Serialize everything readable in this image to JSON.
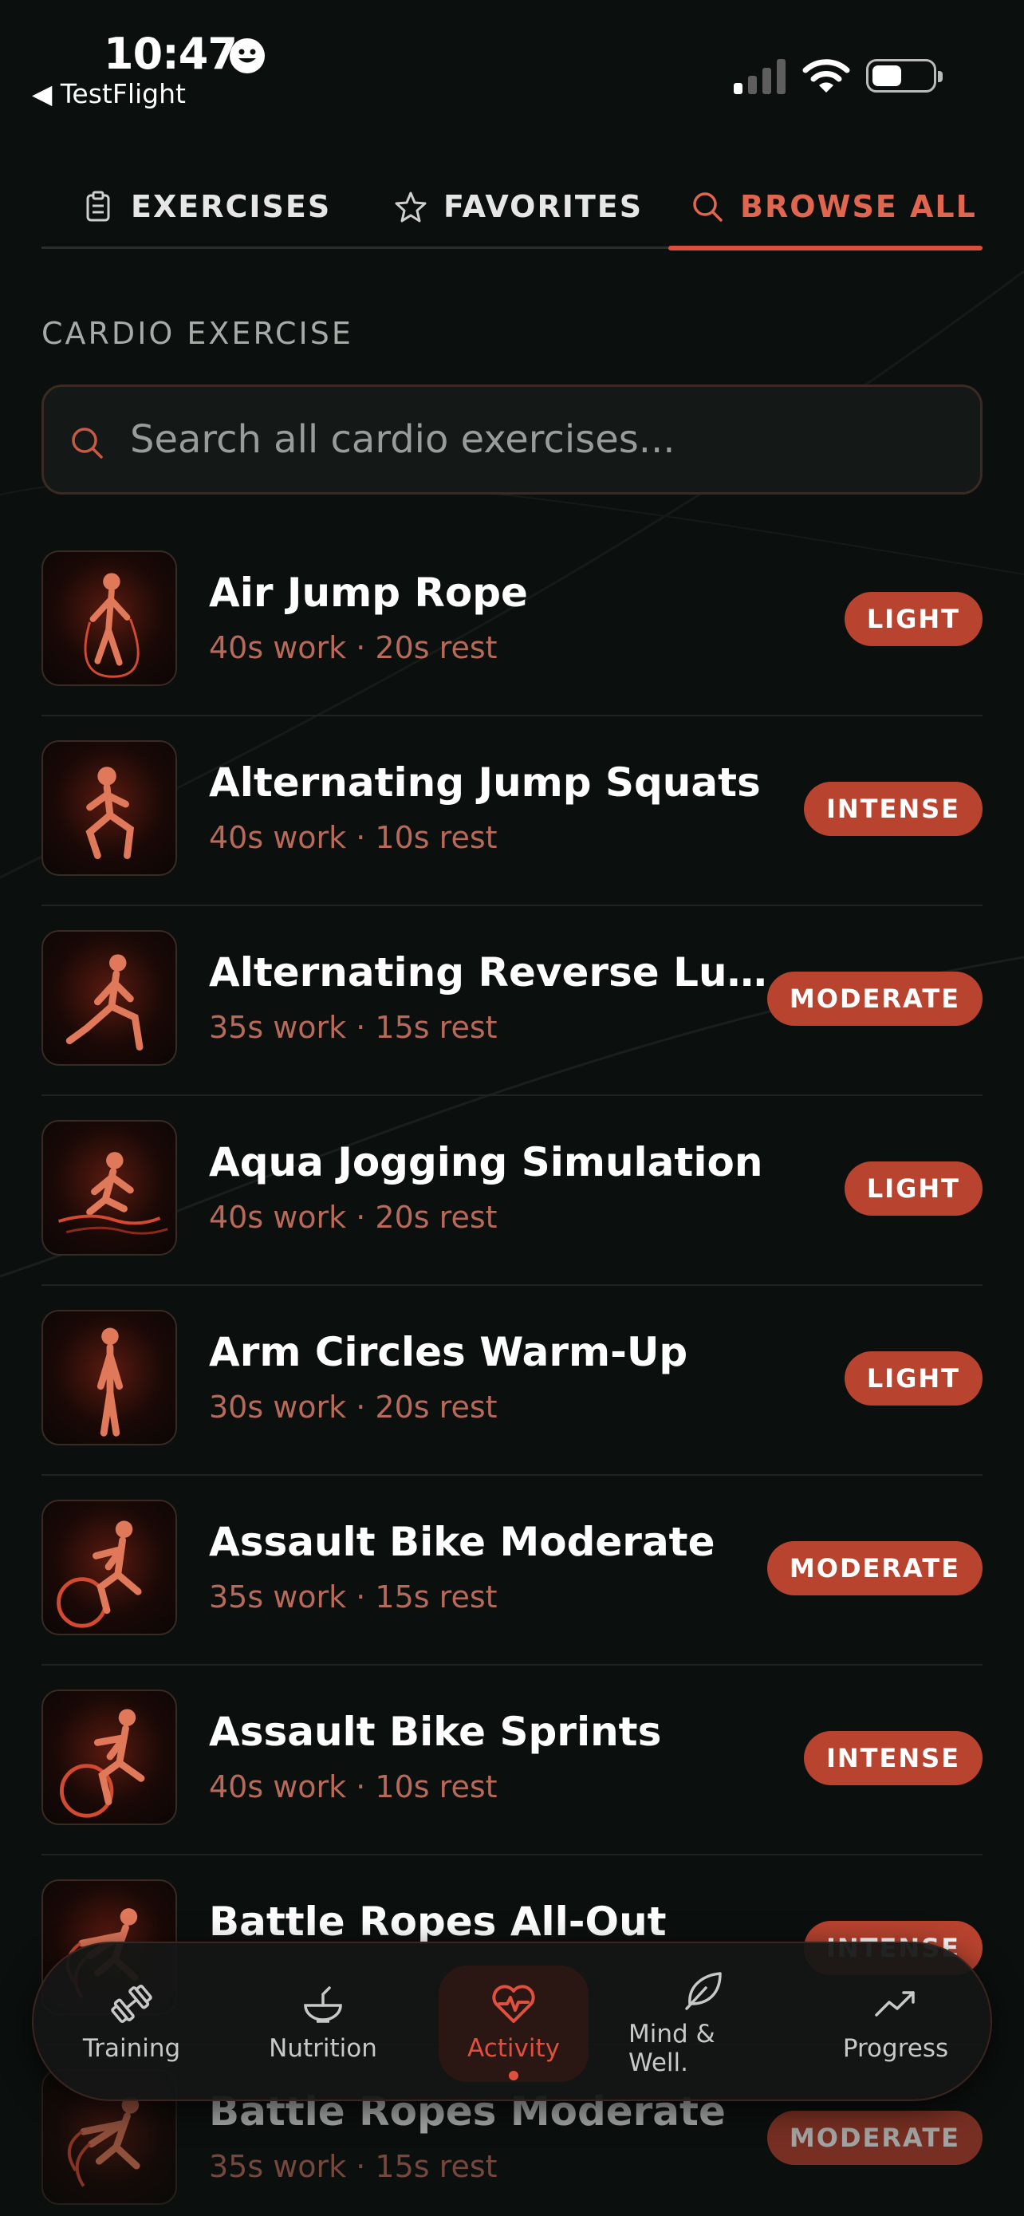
{
  "status_bar": {
    "time": "10:47",
    "back_app": "◀ TestFlight"
  },
  "tabs": [
    {
      "label": "EXERCISES",
      "icon": "clipboard-icon",
      "active": false
    },
    {
      "label": "FAVORITES",
      "icon": "star-icon",
      "active": false
    },
    {
      "label": "BROWSE ALL",
      "icon": "search-icon",
      "active": true
    }
  ],
  "section": {
    "title": "CARDIO EXERCISE"
  },
  "search": {
    "placeholder": "Search all cardio exercises..."
  },
  "exercises": [
    {
      "name": "Air Jump Rope",
      "meta": "40s work · 20s rest",
      "intensity": "LIGHT"
    },
    {
      "name": "Alternating Jump Squats",
      "meta": "40s work · 10s rest",
      "intensity": "INTENSE"
    },
    {
      "name": "Alternating Reverse Lung...",
      "meta": "35s work · 15s rest",
      "intensity": "MODERATE"
    },
    {
      "name": "Aqua Jogging Simulation",
      "meta": "40s work · 20s rest",
      "intensity": "LIGHT"
    },
    {
      "name": "Arm Circles Warm-Up",
      "meta": "30s work · 20s rest",
      "intensity": "LIGHT"
    },
    {
      "name": "Assault Bike Moderate",
      "meta": "35s work · 15s rest",
      "intensity": "MODERATE"
    },
    {
      "name": "Assault Bike Sprints",
      "meta": "40s work · 10s rest",
      "intensity": "INTENSE"
    },
    {
      "name": "Battle Ropes All-Out",
      "meta": "",
      "intensity": "INTENSE"
    },
    {
      "name": "Battle Ropes Moderate",
      "meta": "35s work · 15s rest",
      "intensity": "MODERATE"
    }
  ],
  "bottom_nav": [
    {
      "label": "Training",
      "icon": "dumbbell-icon",
      "active": false
    },
    {
      "label": "Nutrition",
      "icon": "bowl-icon",
      "active": false
    },
    {
      "label": "Activity",
      "icon": "heart-pulse-icon",
      "active": true
    },
    {
      "label": "Mind & Well.",
      "icon": "leaf-icon",
      "active": false
    },
    {
      "label": "Progress",
      "icon": "trending-up-icon",
      "active": false
    }
  ],
  "colors": {
    "accent": "#e0503e",
    "badge": "#b8432f",
    "background": "#0b0f0d",
    "meta_text": "#b86a5a"
  }
}
